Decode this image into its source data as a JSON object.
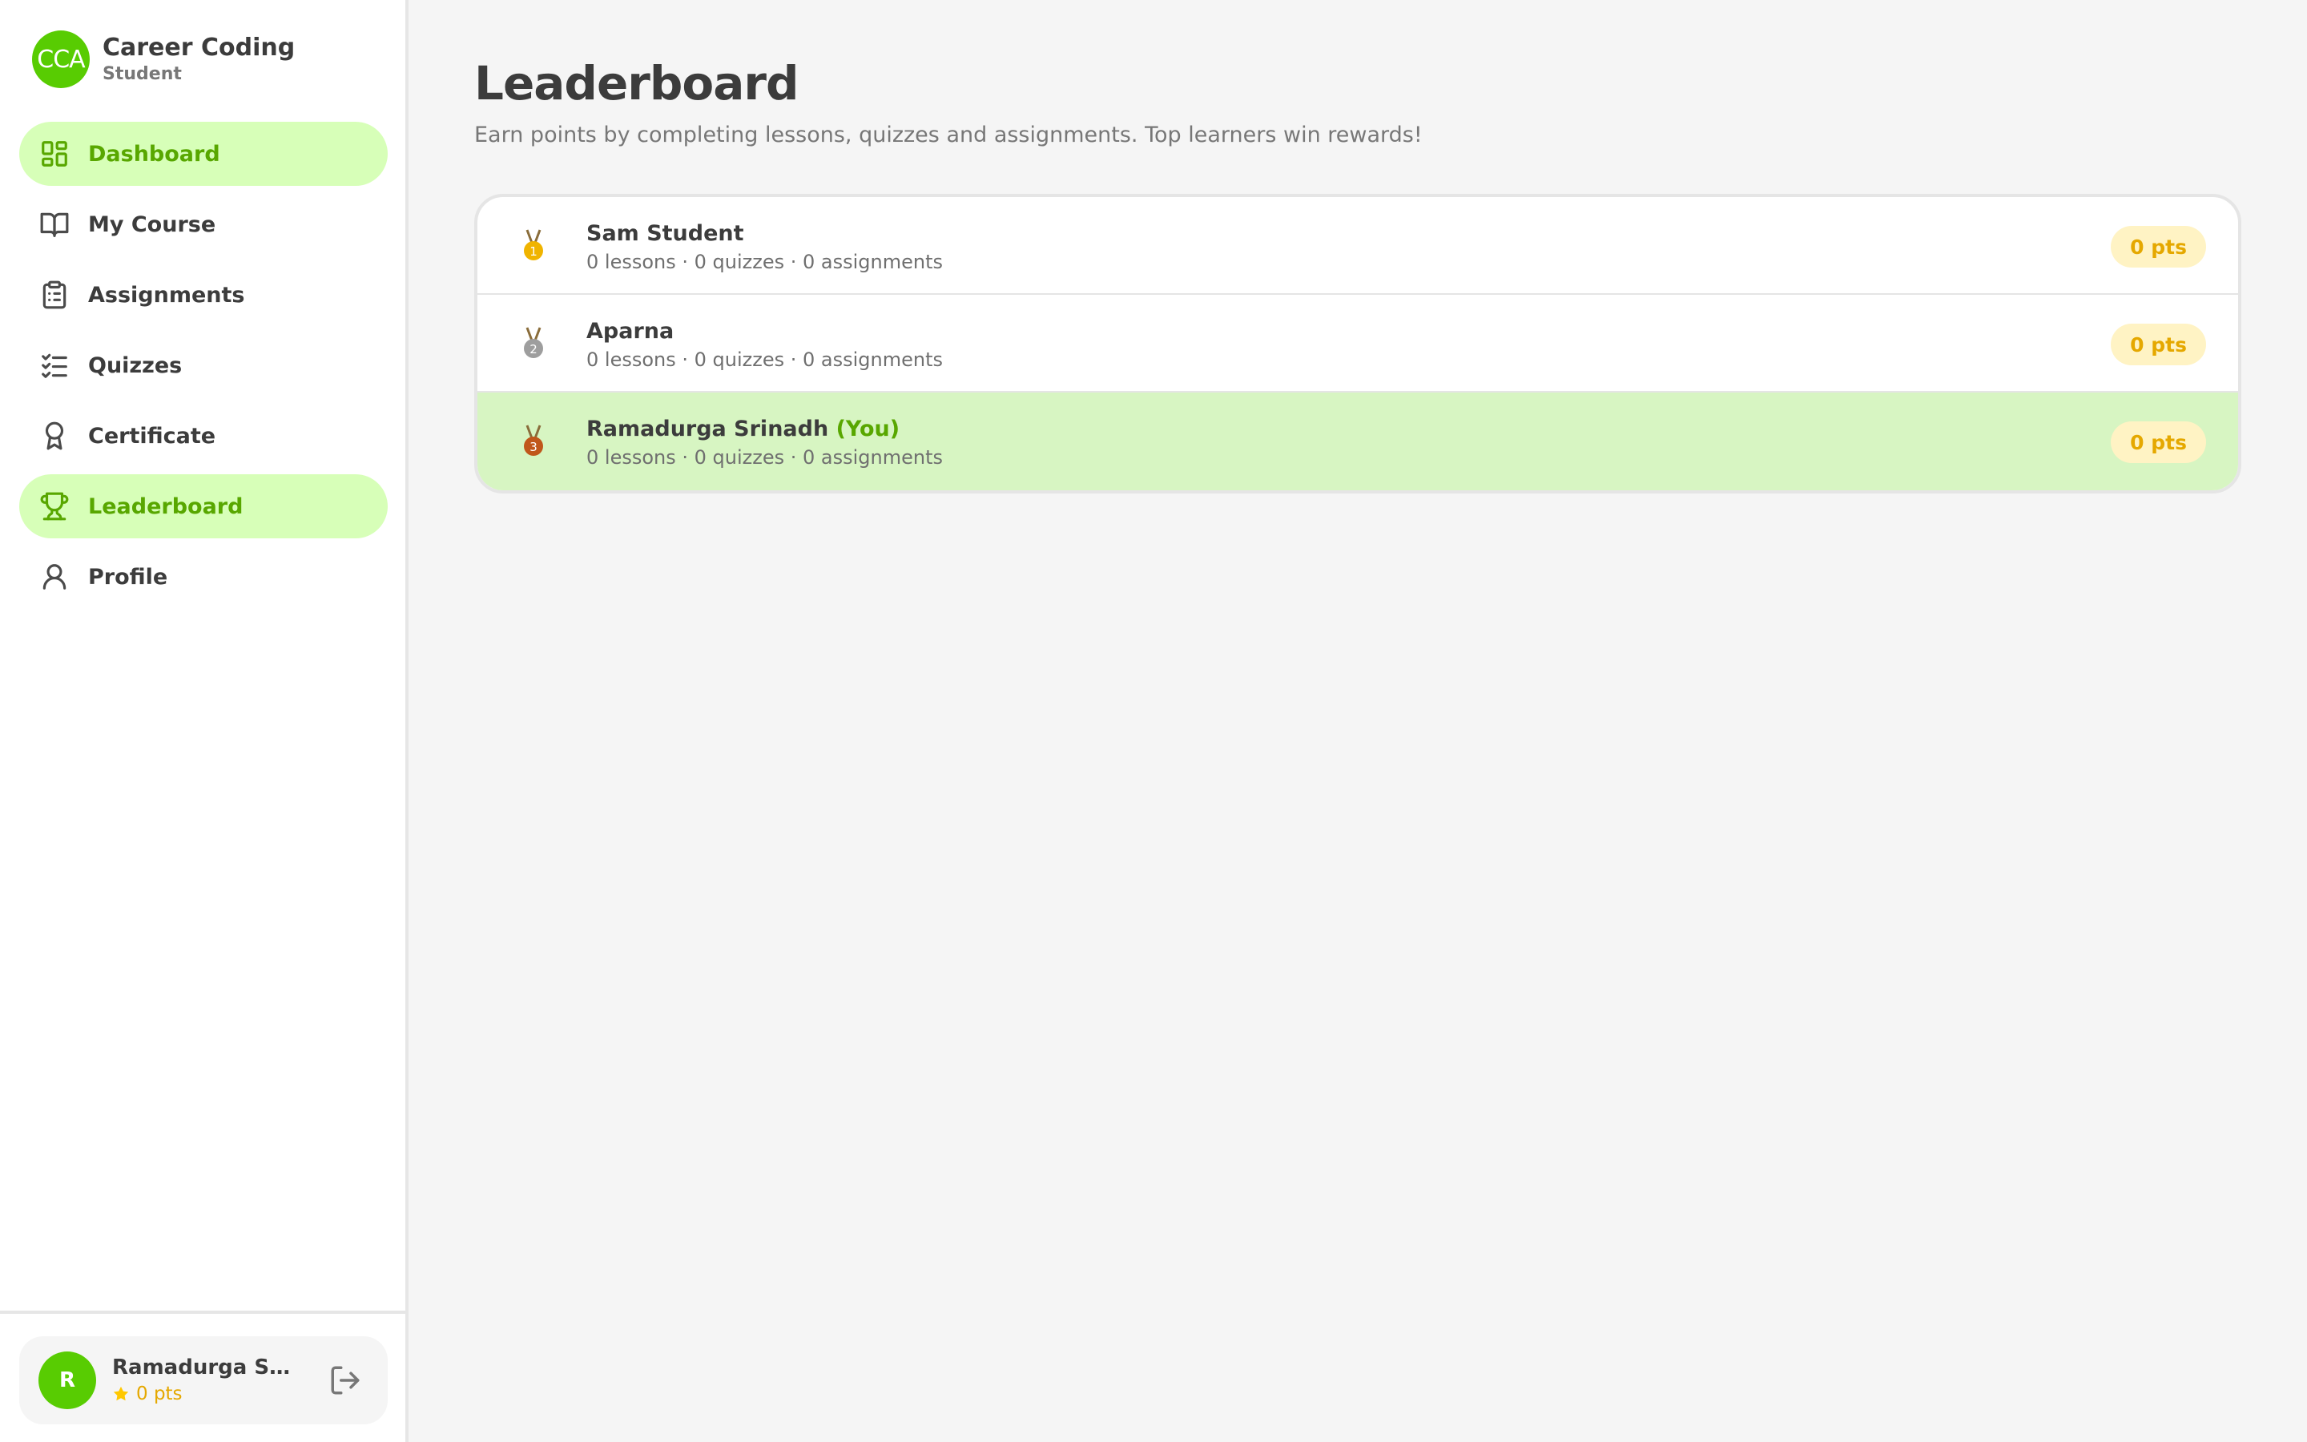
{
  "brand": {
    "logo_text": "CCA",
    "name": "Career Coding",
    "role": "Student",
    "accent": "#58cc02"
  },
  "sidebar": {
    "items": [
      {
        "label": "Dashboard",
        "icon": "dashboard-icon",
        "active": true
      },
      {
        "label": "My Course",
        "icon": "book-icon",
        "active": false
      },
      {
        "label": "Assignments",
        "icon": "clipboard-icon",
        "active": false
      },
      {
        "label": "Quizzes",
        "icon": "checklist-icon",
        "active": false
      },
      {
        "label": "Certificate",
        "icon": "award-icon",
        "active": false
      },
      {
        "label": "Leaderboard",
        "icon": "trophy-icon",
        "active": true
      },
      {
        "label": "Profile",
        "icon": "user-icon",
        "active": false
      }
    ]
  },
  "user": {
    "initial": "R",
    "name": "Ramadurga Sri...",
    "points": "0 pts"
  },
  "page": {
    "title": "Leaderboard",
    "subtitle": "Earn points by completing lessons, quizzes and assignments. Top learners win rewards!"
  },
  "leaderboard": [
    {
      "rank": "1",
      "name": "Sam Student",
      "you": "",
      "stats": "0 lessons · 0 quizzes · 0 assignments",
      "points": "0 pts",
      "medal_color": "#f0b400",
      "ribbon_color": "#8a6d3b"
    },
    {
      "rank": "2",
      "name": "Aparna",
      "you": "",
      "stats": "0 lessons · 0 quizzes · 0 assignments",
      "points": "0 pts",
      "medal_color": "#9e9e9e",
      "ribbon_color": "#8a6d3b"
    },
    {
      "rank": "3",
      "name": "Ramadurga Srinadh",
      "you": "(You)",
      "stats": "0 lessons · 0 quizzes · 0 assignments",
      "points": "0 pts",
      "medal_color": "#c0571b",
      "ribbon_color": "#8a6d3b"
    }
  ],
  "colors": {
    "active_bg": "#d7ffb8",
    "active_text": "#58a700",
    "pts_bg": "#fff3c4",
    "pts_text": "#e5a800",
    "me_row_bg": "#d7f5c2"
  }
}
